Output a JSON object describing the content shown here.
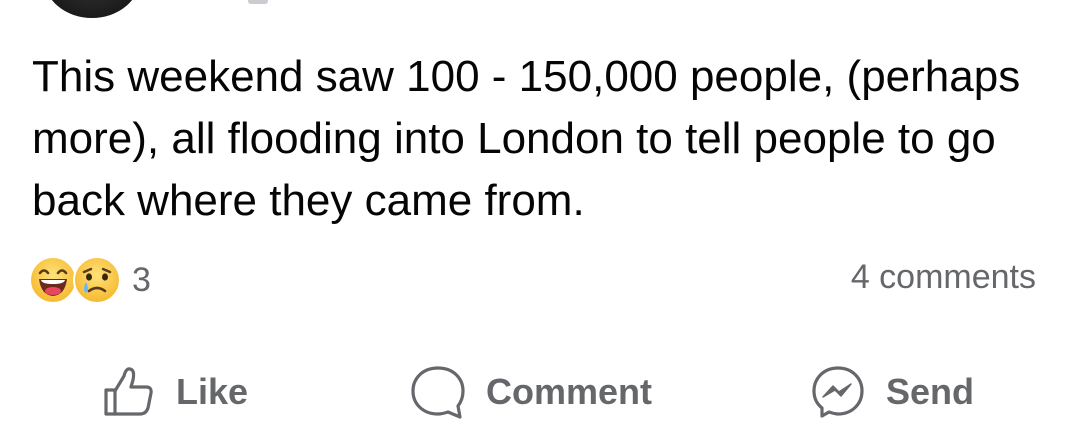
{
  "post": {
    "text": "This weekend saw 100 - 150,000 people, (perhaps more), all flooding into London to tell people to go back where they came from."
  },
  "reactions": {
    "icons": [
      "haha-icon",
      "sad-icon"
    ],
    "count": "3"
  },
  "comments": {
    "label": "4 comments"
  },
  "actions": {
    "like_label": "Like",
    "comment_label": "Comment",
    "send_label": "Send"
  },
  "colors": {
    "text": "#050505",
    "muted": "#65676b",
    "reaction_yellow": "#fbd24e",
    "reaction_tear": "#6ab7f5"
  }
}
